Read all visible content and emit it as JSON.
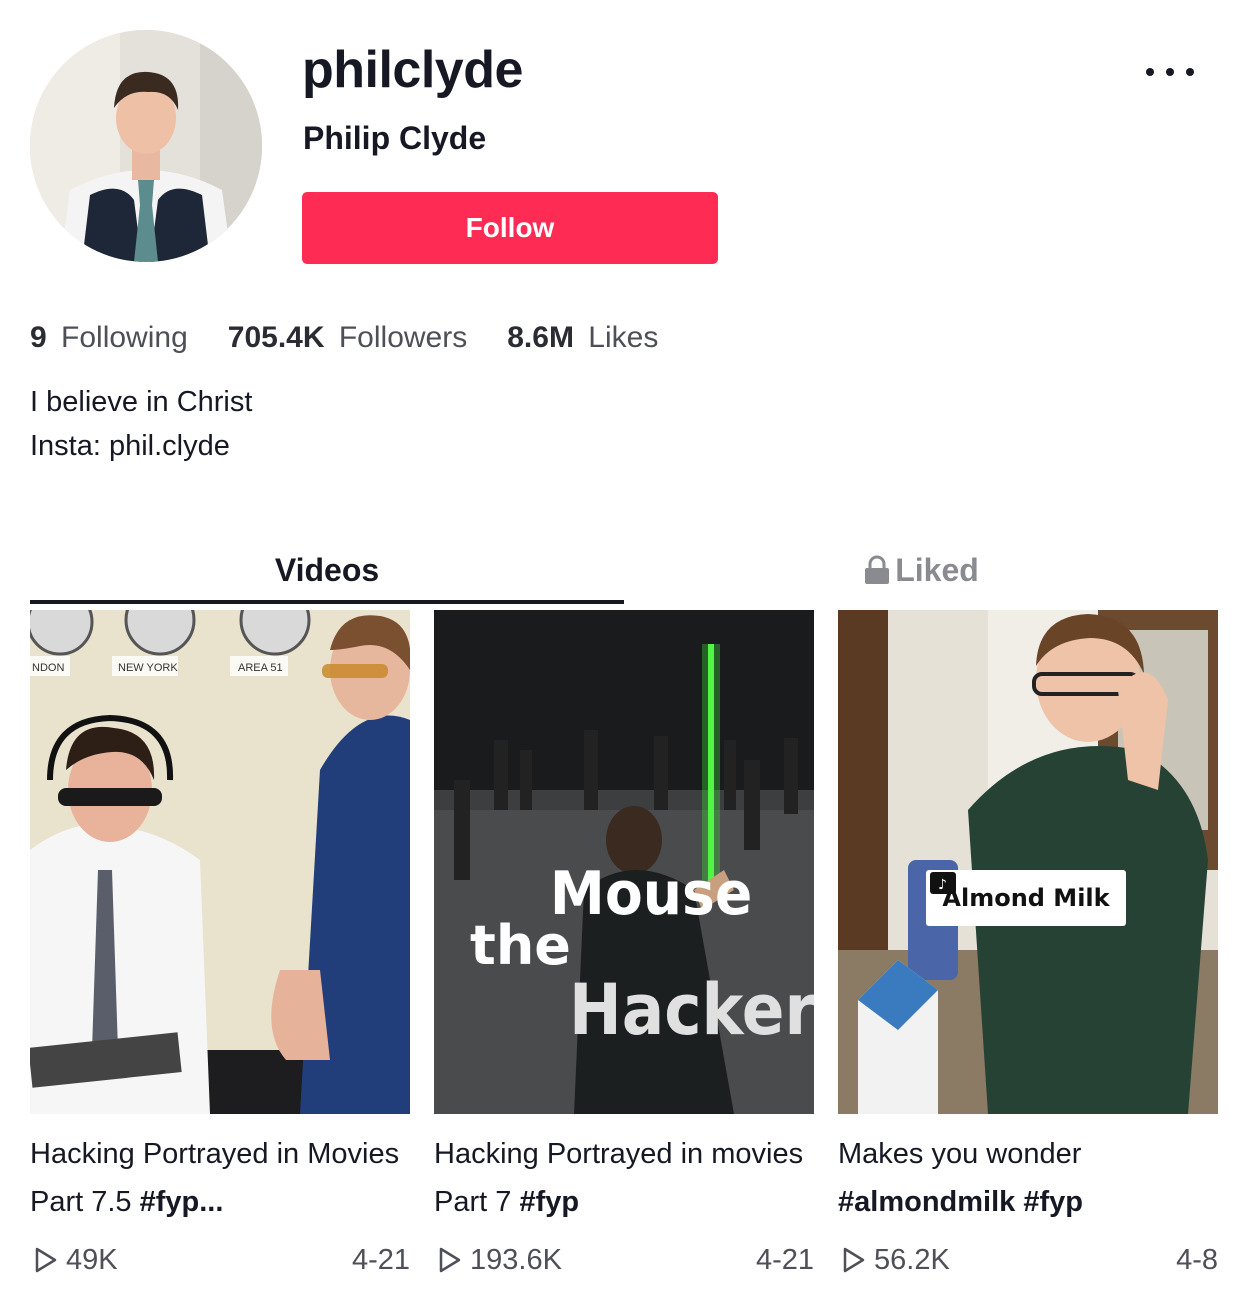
{
  "profile": {
    "username": "philclyde",
    "display_name": "Philip Clyde",
    "follow_label": "Follow"
  },
  "stats": {
    "following_count": "9",
    "following_label": "Following",
    "followers_count": "705.4K",
    "followers_label": "Followers",
    "likes_count": "8.6M",
    "likes_label": "Likes"
  },
  "bio": {
    "line1": "I believe in Christ",
    "line2": "Insta: phil.clyde"
  },
  "tabs": {
    "videos_label": "Videos",
    "liked_label": "Liked"
  },
  "videos": [
    {
      "caption_text": "Hacking Portrayed in Movies Part 7.5 ",
      "caption_tag": "#fyp...",
      "views": "49K",
      "date": "4-21",
      "clock_labels": [
        "NDON",
        "NEW YORK",
        "AREA 51"
      ]
    },
    {
      "caption_text": "Hacking Portrayed in movies Part 7 ",
      "caption_tag": "#fyp",
      "views": "193.6K",
      "date": "4-21",
      "overlay_the": "the",
      "overlay_mouse": "Mouse",
      "overlay_hacker": "Hacker"
    },
    {
      "caption_text": "Makes you wonder ",
      "caption_tag": "#almondmilk #fyp",
      "views": "56.2K",
      "date": "4-8",
      "sticker_label": "Almond Milk"
    }
  ],
  "colors": {
    "follow_bg": "#fe2c55",
    "text_primary": "#161823",
    "text_secondary": "#8a8b91"
  }
}
